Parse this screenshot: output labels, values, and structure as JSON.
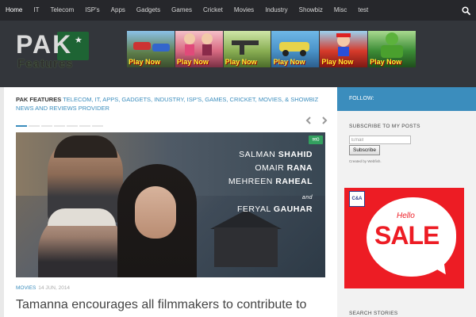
{
  "nav": {
    "items": [
      "Home",
      "IT",
      "Telecom",
      "ISP's",
      "Apps",
      "Gadgets",
      "Games",
      "Cricket",
      "Movies",
      "Industry",
      "Showbiz",
      "Misc",
      "test"
    ],
    "active": "Home"
  },
  "header": {
    "logo": {
      "line1": "PAK",
      "line2": "Features"
    },
    "banner": {
      "games": [
        "Play Now",
        "Play Now",
        "Play Now",
        "Play Now",
        "Play Now",
        "Play Now"
      ]
    }
  },
  "main": {
    "tagline": {
      "site": "PAK FEATURES",
      "desc": "TELECOM, IT, APPS, GADGETS, INDUSTRY, ISP'S, GAMES, CRICKET, MOVIES, & SHOWBIZ NEWS AND REVIEWS PROVIDER"
    },
    "featured": {
      "comments": "0",
      "credits": {
        "c1_first": "SALMAN",
        "c1_last": "SHAHID",
        "c2_first": "OMAIR",
        "c2_last": "RANA",
        "c3_first": "MEHREEN",
        "c3_last": "RAHEAL",
        "and": "and",
        "c4_first": "FERYAL",
        "c4_last": "GAUHAR"
      }
    },
    "post": {
      "category": "MOVIES",
      "date": "14 JUN, 2014",
      "title": "Tamanna encourages all filmmakers to contribute to"
    }
  },
  "sidebar": {
    "follow": "FOLLOW:",
    "subscribe_title": "SUBSCRIBE TO MY POSTS",
    "email_placeholder": "Email",
    "subscribe_button": "Subscribe",
    "created_by": "Created by Webfish.",
    "ad": {
      "brand": "C&A",
      "hello": "Hello",
      "sale": "SALE"
    },
    "search_title": "SEARCH STORIES"
  },
  "colors": {
    "accent": "#3b8dbd",
    "nav_bg": "#26272b",
    "header_bg": "#33363b",
    "ad_red": "#ed1c24"
  }
}
